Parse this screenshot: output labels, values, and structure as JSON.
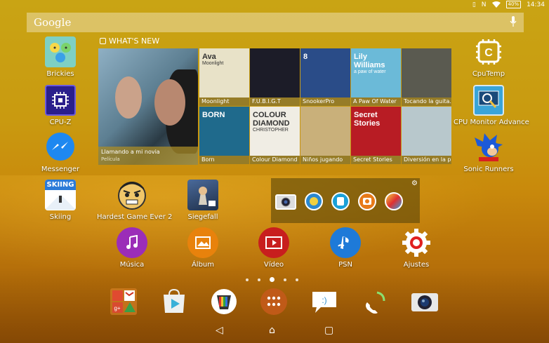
{
  "status": {
    "time": "14:34",
    "battery": "40%"
  },
  "search": {
    "brand": "Google"
  },
  "left_apps": [
    {
      "label": "Brickies"
    },
    {
      "label": "CPU-Z"
    },
    {
      "label": "Messenger"
    },
    {
      "label": "Skiing",
      "tile_text": "SKIING"
    }
  ],
  "right_apps": [
    {
      "label": "CpuTemp"
    },
    {
      "label": "CPU Monitor Advance"
    },
    {
      "label": "Sonic Runners"
    }
  ],
  "mid_apps": [
    {
      "label": "Hardest Game Ever 2"
    },
    {
      "label": "Siegefall"
    }
  ],
  "whats_new": {
    "header": "WHAT'S NEW",
    "featured": {
      "title": "Llamando a mi novia",
      "subtitle": "Película"
    },
    "tiles": [
      {
        "label": "Moonlight",
        "art_text": "Ava",
        "art_text2": "Moonlight",
        "color": "#e8e2c8"
      },
      {
        "label": "F.U.B.I.G.T",
        "art_text": "",
        "art_text2": "",
        "color": "#1c1c28"
      },
      {
        "label": "SnookerPro",
        "art_text": "8",
        "art_text2": "",
        "color": "#2a4c88"
      },
      {
        "label": "A Paw Of Water",
        "art_text": "Lily Williams",
        "art_text2": "a paw of water",
        "color": "#6bbad8"
      },
      {
        "label": "Tocando la guita.",
        "art_text": "",
        "art_text2": "",
        "color": "#5a5a50"
      },
      {
        "label": "Born",
        "art_text": "BORN",
        "art_text2": "",
        "color": "#1f6a8c"
      },
      {
        "label": "Colour Diamond",
        "art_text": "COLOUR DIAMOND",
        "art_text2": "CHRISTOPHER",
        "color": "#f0ede4"
      },
      {
        "label": "Niños jugando",
        "art_text": "",
        "art_text2": "",
        "color": "#c9b07a"
      },
      {
        "label": "Secret Stories",
        "art_text": "Secret Stories",
        "art_text2": "",
        "color": "#b81c24"
      },
      {
        "label": "Diversión en la pl.",
        "art_text": "",
        "art_text2": "",
        "color": "#b8c8cc"
      }
    ]
  },
  "bottom_apps": [
    {
      "label": "Música"
    },
    {
      "label": "Álbum"
    },
    {
      "label": "Vídeo"
    },
    {
      "label": "PSN"
    },
    {
      "label": "Ajustes"
    }
  ],
  "colors": {
    "accent": "#c99a10",
    "musica": "#9b2db8",
    "album": "#e8820c",
    "video": "#c81e1e",
    "psn": "#1e7ad8",
    "ajustes": "#e02020"
  }
}
